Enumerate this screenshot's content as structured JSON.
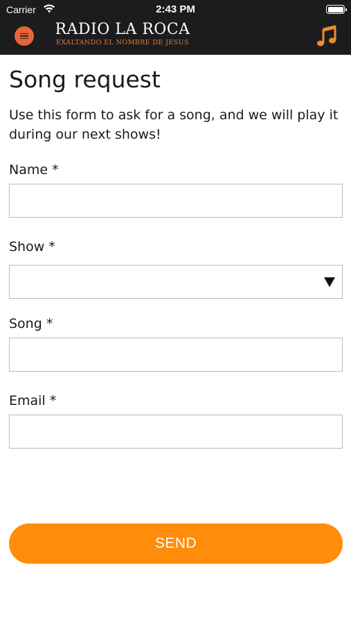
{
  "status_bar": {
    "carrier": "Carrier",
    "time": "2:43 PM",
    "icons": [
      "wifi-icon",
      "battery-icon"
    ]
  },
  "header": {
    "menu_icon": "hamburger-menu-icon",
    "logo_title": "RADIO LA ROCA",
    "logo_subtitle": "EXALTANDO EL NOMBRE DE JESUS",
    "music_icon": "music-note-icon",
    "colors": {
      "background": "#1c1c1e",
      "accent": "#e8643a",
      "logo_sub": "#e07a2c"
    }
  },
  "page": {
    "title": "Song request",
    "intro": "Use this form to ask for a song, and we will play it during our next shows!"
  },
  "form": {
    "name": {
      "label": "Name *",
      "value": "",
      "placeholder": ""
    },
    "show": {
      "label": "Show *",
      "selected": ""
    },
    "song": {
      "label": "Song *",
      "value": "",
      "placeholder": ""
    },
    "email": {
      "label": "Email *",
      "value": "",
      "placeholder": ""
    },
    "submit_label": "SEND",
    "submit_color": "#ff8c0a"
  }
}
